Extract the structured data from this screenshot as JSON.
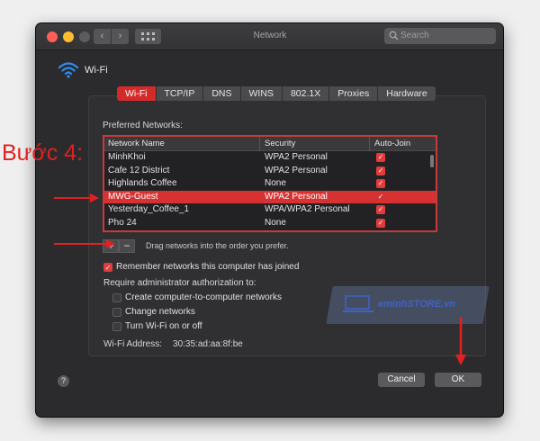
{
  "window": {
    "title": "Network"
  },
  "search": {
    "placeholder": "Search"
  },
  "header": {
    "service": "Wi-Fi"
  },
  "tabs": [
    "Wi-Fi",
    "TCP/IP",
    "DNS",
    "WINS",
    "802.1X",
    "Proxies",
    "Hardware"
  ],
  "preferred_label": "Preferred Networks:",
  "table": {
    "columns": [
      "Network Name",
      "Security",
      "Auto-Join"
    ],
    "rows": [
      {
        "name": "MinhKhoi",
        "security": "WPA2 Personal",
        "auto_join": true
      },
      {
        "name": "Cafe 12 District",
        "security": "WPA2 Personal",
        "auto_join": true
      },
      {
        "name": "Highlands Coffee",
        "security": "None",
        "auto_join": true
      },
      {
        "name": "MWG-Guest",
        "security": "WPA2 Personal",
        "auto_join": true,
        "selected": true
      },
      {
        "name": "Yesterday_Coffee_1",
        "security": "WPA/WPA2 Personal",
        "auto_join": true
      },
      {
        "name": "Pho 24",
        "security": "None",
        "auto_join": true
      }
    ]
  },
  "controls": {
    "add": "+",
    "remove": "−",
    "drag_hint": "Drag networks into the order you prefer."
  },
  "remember": {
    "label": "Remember networks this computer has joined",
    "checked": true
  },
  "admin": {
    "label": "Require administrator authorization to:",
    "options": [
      {
        "label": "Create computer-to-computer networks",
        "checked": false
      },
      {
        "label": "Change networks",
        "checked": false
      },
      {
        "label": "Turn Wi-Fi on or off",
        "checked": false
      }
    ]
  },
  "address": {
    "label": "Wi-Fi Address:",
    "value": "30:35:ad:aa:8f:be"
  },
  "buttons": {
    "help": "?",
    "cancel": "Cancel",
    "ok": "OK"
  },
  "annotation": {
    "step": "Bước 4:"
  },
  "watermark": {
    "text": "eminhSTORE.vn"
  },
  "colors": {
    "accent": "#d52a2a",
    "annotation": "#e12020",
    "window_bg": "#2b2b2d"
  }
}
